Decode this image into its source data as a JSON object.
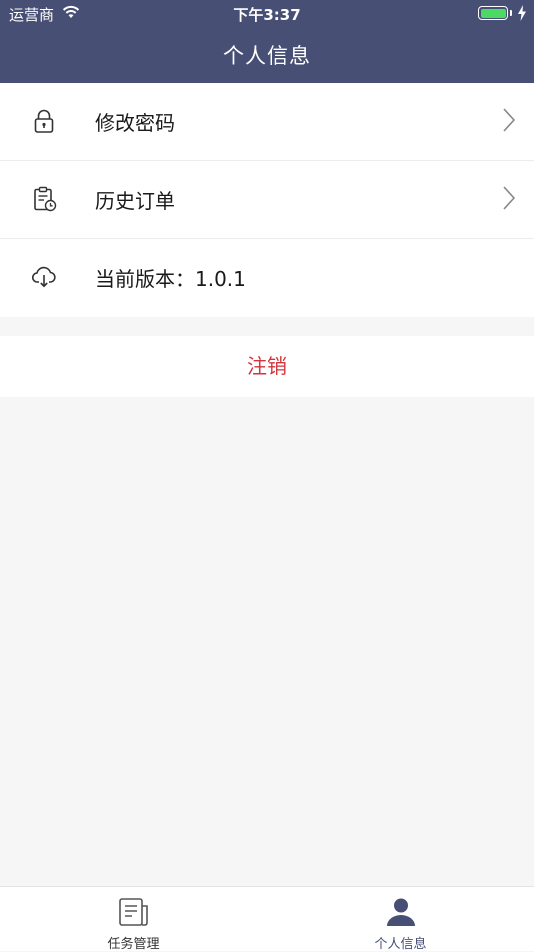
{
  "status_bar": {
    "carrier": "运营商",
    "time": "下午3:37"
  },
  "header": {
    "title": "个人信息"
  },
  "menu": {
    "items": [
      {
        "label": "修改密码",
        "icon": "lock-icon"
      },
      {
        "label": "历史订单",
        "icon": "order-history-icon"
      },
      {
        "label": "当前版本：1.0.1",
        "icon": "cloud-download-icon"
      }
    ]
  },
  "logout": {
    "label": "注销"
  },
  "tabbar": {
    "tabs": [
      {
        "label": "任务管理",
        "icon": "document-icon"
      },
      {
        "label": "个人信息",
        "icon": "person-icon"
      }
    ]
  },
  "colors": {
    "header_bg": "#474f75",
    "logout_text": "#d0343c",
    "battery": "#4cd964"
  }
}
